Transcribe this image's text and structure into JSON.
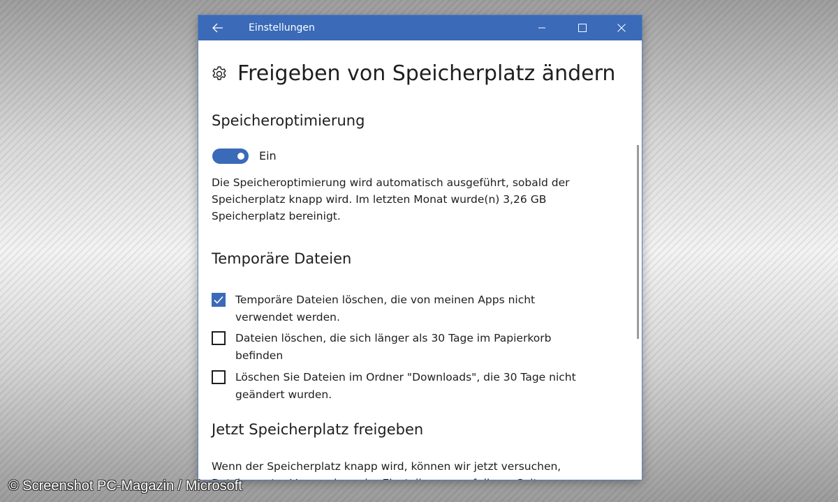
{
  "window": {
    "title": "Einstellungen",
    "accent_color": "#3a6ab8"
  },
  "titlebar": {
    "back_icon": "arrow-left-icon",
    "minimize_icon": "minimize-icon",
    "maximize_icon": "maximize-icon",
    "close_icon": "close-icon"
  },
  "page": {
    "icon": "gear-icon",
    "title": "Freigeben von Speicherplatz ändern"
  },
  "storage_sense": {
    "heading": "Speicheroptimierung",
    "toggle_state": "on",
    "toggle_label": "Ein",
    "description": "Die Speicheroptimierung wird automatisch ausgeführt, sobald der Speicherplatz knapp wird. Im letzten Monat wurde(n) 3,26 GB Speicherplatz bereinigt."
  },
  "temp_files": {
    "heading": "Temporäre Dateien",
    "options": [
      {
        "label": "Temporäre Dateien löschen, die von meinen Apps nicht verwendet werden.",
        "checked": true
      },
      {
        "label": "Dateien löschen, die sich länger als 30 Tage im Papierkorb befinden",
        "checked": false
      },
      {
        "label": "Löschen Sie Dateien im Ordner \"Downloads\", die 30 Tage nicht geändert wurden.",
        "checked": false
      }
    ]
  },
  "free_now": {
    "heading": "Jetzt Speicherplatz freigeben",
    "description": "Wenn der Speicherplatz knapp wird, können wir jetzt versuchen, Dateien unter Verwendung der Einstellungen auf dieser Seite zu"
  },
  "copyright": "© Screenshot PC-Magazin / Microsoft"
}
